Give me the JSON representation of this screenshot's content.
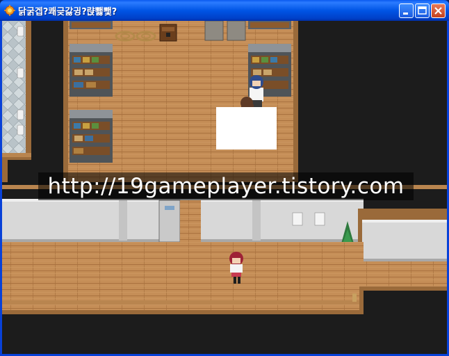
{
  "window": {
    "title": "닭굵겝?쾌긎갏귕?랹뾇뾏?",
    "icon": "game-app-icon",
    "buttons": [
      "minimize-icon",
      "maximize-icon",
      "close-icon"
    ]
  },
  "overlay": {
    "watermark_text": "http://19gameplayer.tistory.com"
  },
  "colors": {
    "titlebar": "#0055E5",
    "floor": "#C9915A",
    "wall": "#D8D8D8",
    "void": "#1C1C1C",
    "trim": "#9A6A3A"
  },
  "scene": {
    "characters": [
      "blue-haired-npc",
      "brown-haired-npc",
      "red-haired-player"
    ],
    "objects": [
      "shelf-storage",
      "rope-coil",
      "crate",
      "potted-plant",
      "door",
      "wall-poster",
      "sink"
    ]
  }
}
